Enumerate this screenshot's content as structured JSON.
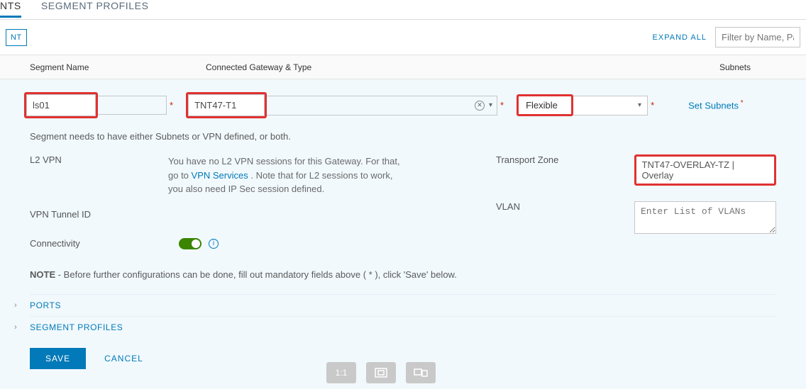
{
  "tabs": {
    "first": "NTS",
    "second": "SEGMENT PROFILES"
  },
  "toolbar": {
    "add_btn": "NT",
    "expand_all": "EXPAND ALL",
    "filter_placeholder": "Filter by Name, Path o"
  },
  "headers": {
    "segment_name": "Segment Name",
    "gateway": "Connected Gateway & Type",
    "subnets": "Subnets"
  },
  "inputs": {
    "segment_name_value": "ls01",
    "gateway_value": "TNT47-T1",
    "type_value": "Flexible",
    "set_subnets_label": "Set Subnets"
  },
  "details": {
    "segment_note": "Segment needs to have either Subnets or VPN defined, or both.",
    "l2vpn_label": "L2 VPN",
    "l2vpn_text_prefix": "You have no L2 VPN sessions for this Gateway. For that, go to ",
    "l2vpn_link": "VPN Services",
    "l2vpn_text_suffix": " . Note that for L2 sessions to work, you also need IP Sec session defined.",
    "tunnel_label": "VPN Tunnel ID",
    "connectivity_label": "Connectivity",
    "tz_label": "Transport Zone",
    "tz_value": "TNT47-OVERLAY-TZ | Overlay",
    "vlan_label": "VLAN",
    "vlan_placeholder": "Enter List of VLANs",
    "mandatory_note_prefix": "NOTE",
    "mandatory_note_text": " - Before further configurations can be done, fill out mandatory fields above ( * ), click 'Save' below.",
    "ports_section": "PORTS",
    "profiles_section": "SEGMENT PROFILES",
    "save_label": "SAVE",
    "cancel_label": "CANCEL"
  }
}
